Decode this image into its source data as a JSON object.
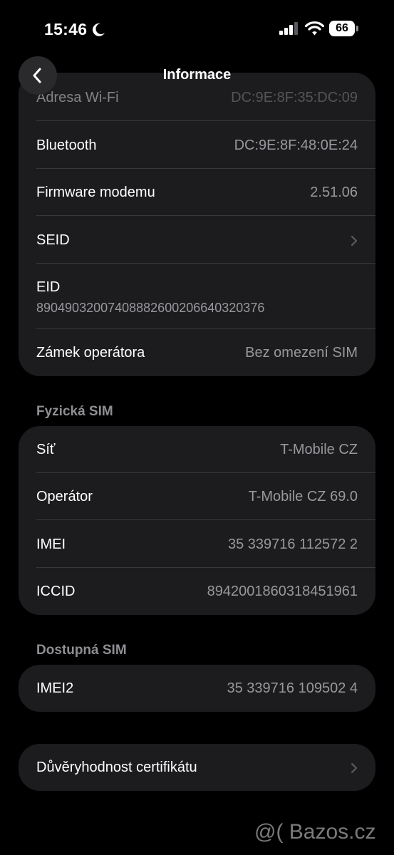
{
  "status_bar": {
    "time": "15:46",
    "battery": "66"
  },
  "nav": {
    "title": "Informace"
  },
  "about_group": {
    "wifi_label": "Adresa Wi-Fi",
    "wifi_value": "DC:9E:8F:35:DC:09",
    "bluetooth_label": "Bluetooth",
    "bluetooth_value": "DC:9E:8F:48:0E:24",
    "modem_label": "Firmware modemu",
    "modem_value": "2.51.06",
    "seid_label": "SEID",
    "eid_label": "EID",
    "eid_value": "89049032007408882600206640320376",
    "lock_label": "Zámek operátora",
    "lock_value": "Bez omezení SIM"
  },
  "physical_sim": {
    "header": "Fyzická SIM",
    "network_label": "Síť",
    "network_value": "T-Mobile CZ",
    "carrier_label": "Operátor",
    "carrier_value": "T-Mobile CZ 69.0",
    "imei_label": "IMEI",
    "imei_value": "35 339716 112572 2",
    "iccid_label": "ICCID",
    "iccid_value": "8942001860318451961"
  },
  "available_sim": {
    "header": "Dostupná SIM",
    "imei2_label": "IMEI2",
    "imei2_value": "35 339716 109502 4"
  },
  "certificate": {
    "label": "Důvěryhodnost certifikátu"
  },
  "watermark": "@( Bazos.cz",
  "colors": {
    "background": "#000000",
    "cell": "#1c1c1e",
    "secondary_text": "#98989d",
    "separator": "#38383a"
  }
}
